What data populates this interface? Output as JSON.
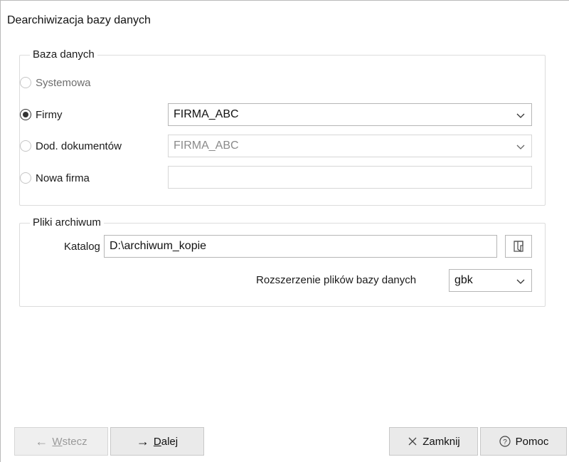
{
  "dialog": {
    "title": "Dearchiwizacja bazy danych"
  },
  "database_group": {
    "legend": "Baza danych",
    "options": [
      {
        "label": "Systemowa",
        "checked": false,
        "enabled": false
      },
      {
        "label": "Firmy",
        "checked": true,
        "enabled": true,
        "value": "FIRMA_ABC"
      },
      {
        "label": "Dod. dokumentów",
        "checked": false,
        "enabled": false,
        "value": "FIRMA_ABC"
      },
      {
        "label": "Nowa firma",
        "checked": false,
        "enabled": true,
        "value": ""
      }
    ]
  },
  "archive_group": {
    "legend": "Pliki archiwum",
    "directory_label": "Katalog",
    "directory_value": "D:\\archiwum_kopie",
    "extension_label": "Rozszerzenie plików bazy danych",
    "extension_value": "gbk"
  },
  "buttons": {
    "back_arrow": "←",
    "back_ul": "W",
    "back_rest": "stecz",
    "next_arrow": "→",
    "next_ul": "D",
    "next_rest": "alej",
    "close_label": "Zamknij",
    "help_label": "Pomoc"
  },
  "icons": {
    "chevron": "chevron-down-icon",
    "folder": "folder-icon",
    "close": "close-icon",
    "help": "help-icon"
  }
}
